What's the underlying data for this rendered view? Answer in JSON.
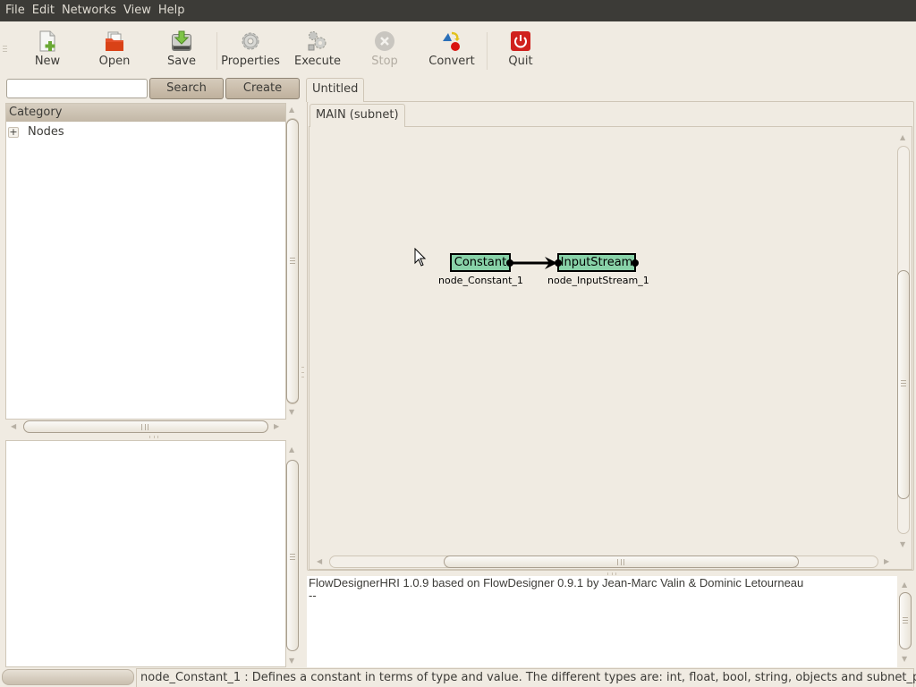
{
  "menubar": {
    "items": [
      "File",
      "Edit",
      "Networks",
      "View",
      "Help"
    ]
  },
  "toolbar": {
    "buttons": [
      {
        "label": "New",
        "icon": "new-document-icon",
        "enabled": true
      },
      {
        "label": "Open",
        "icon": "open-folder-icon",
        "enabled": true
      },
      {
        "label": "Save",
        "icon": "save-disk-icon",
        "enabled": true
      },
      {
        "label": "Properties",
        "icon": "gear-icon",
        "enabled": true
      },
      {
        "label": "Execute",
        "icon": "gears-icon",
        "enabled": true
      },
      {
        "label": "Stop",
        "icon": "stop-icon",
        "enabled": false
      },
      {
        "label": "Convert",
        "icon": "convert-icon",
        "enabled": true
      },
      {
        "label": "Quit",
        "icon": "power-icon",
        "enabled": true
      }
    ]
  },
  "sidebar": {
    "search": {
      "value": "",
      "placeholder": ""
    },
    "search_label": "Search",
    "create_label": "Create",
    "tree": {
      "header": "Category",
      "items": [
        {
          "label": "Nodes",
          "expander": "+"
        }
      ]
    }
  },
  "document": {
    "tab_label": "Untitled",
    "subnet_tab_label": "MAIN (subnet)",
    "nodes": [
      {
        "type": "Constant",
        "name": "node_Constant_1",
        "color": "#88d2a8"
      },
      {
        "type": "InputStream",
        "name": "node_InputStream_1",
        "color": "#88d2a8"
      }
    ],
    "links": [
      {
        "from": "node_Constant_1",
        "to": "node_InputStream_1"
      }
    ]
  },
  "log": {
    "lines": [
      "FlowDesignerHRI 1.0.9 based on FlowDesigner 0.9.1 by Jean-Marc Valin & Dominic Letourneau",
      "--"
    ]
  },
  "statusbar": {
    "text": "node_Constant_1 : Defines a constant in terms of type and value. The different types are: int, float, bool, string, objects and subnet_param."
  }
}
